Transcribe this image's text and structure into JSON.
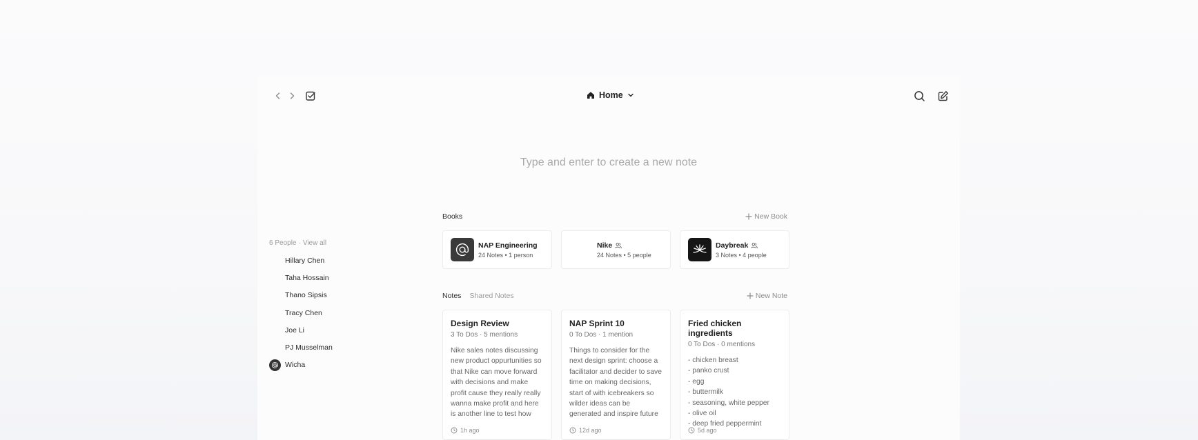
{
  "header": {
    "home_label": "Home"
  },
  "composer": {
    "placeholder": "Type and enter to create a new note"
  },
  "people": {
    "count_label": "6 People",
    "separator": "·",
    "view_all": "View all",
    "items": [
      {
        "name": "Hillary Chen"
      },
      {
        "name": "Taha Hossain"
      },
      {
        "name": "Thano Sipsis"
      },
      {
        "name": "Tracy Chen"
      },
      {
        "name": "Joe Li"
      },
      {
        "name": "PJ Musselman"
      },
      {
        "name": "Wicha"
      }
    ]
  },
  "books": {
    "title": "Books",
    "new_label": "New Book",
    "items": [
      {
        "name": "NAP Engineering",
        "meta": "24 Notes • 1 person"
      },
      {
        "name": "Nike",
        "meta": "24 Notes • 5 people"
      },
      {
        "name": "Daybreak",
        "meta": "3 Notes • 4 people"
      }
    ]
  },
  "notes": {
    "tabs": [
      "Notes",
      "Shared Notes"
    ],
    "new_label": "New Note",
    "items": [
      {
        "title": "Design Review",
        "meta": "3 To Dos · 5 mentions",
        "body": "Nike sales notes discussing new product oppurtunities so that Nike can move forward with decisions and make profit cause they really really wanna make profit and here is another line to test how it…",
        "time": "1h ago"
      },
      {
        "title": "NAP Sprint 10",
        "meta": "0 To Dos · 1 mention",
        "body": "Things to consider for the next design sprint: choose a facilitator and decider to save time on making decisions, start of with icebreakers so wilder ideas can be generated and inspire future rounds of…",
        "time": "12d ago"
      },
      {
        "title": "Fried chicken ingredients",
        "meta": "0 To Dos · 0 mentions",
        "body": "- chicken breast\n- panko crust\n- egg\n- buttermilk\n- seasoning, white pepper\n- olive oil\n- deep fried peppermint",
        "time": "5d ago"
      }
    ]
  }
}
